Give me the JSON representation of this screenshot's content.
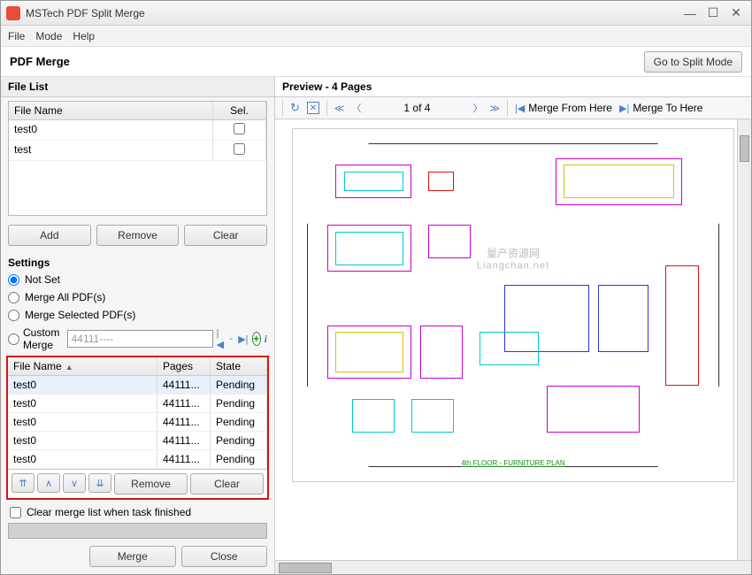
{
  "window": {
    "title": "MSTech PDF Split Merge"
  },
  "menu": {
    "file": "File",
    "mode": "Mode",
    "help": "Help"
  },
  "subtitle": "PDF Merge",
  "go_split": "Go to Split Mode",
  "filelist": {
    "title": "File List",
    "col_name": "File Name",
    "col_sel": "Sel.",
    "rows": [
      {
        "name": "test0",
        "sel": false
      },
      {
        "name": "test",
        "sel": false
      }
    ],
    "add": "Add",
    "remove": "Remove",
    "clear": "Clear"
  },
  "settings": {
    "title": "Settings",
    "not_set": "Not Set",
    "merge_all": "Merge All PDF(s)",
    "merge_selected": "Merge Selected PDF(s)",
    "custom_merge": "Custom Merge",
    "custom_value": "44111----"
  },
  "merge_grid": {
    "col_name": "File Name",
    "col_pages": "Pages",
    "col_state": "State",
    "rows": [
      {
        "name": "test0",
        "pages": "44111...",
        "state": "Pending"
      },
      {
        "name": "test0",
        "pages": "44111...",
        "state": "Pending"
      },
      {
        "name": "test0",
        "pages": "44111...",
        "state": "Pending"
      },
      {
        "name": "test0",
        "pages": "44111...",
        "state": "Pending"
      },
      {
        "name": "test0",
        "pages": "44111...",
        "state": "Pending"
      }
    ],
    "remove": "Remove",
    "clear": "Clear"
  },
  "clear_when_finished": "Clear merge list when task finished",
  "merge_btn": "Merge",
  "close_btn": "Close",
  "preview": {
    "title": "Preview - 4 Pages",
    "page_of": "1 of 4",
    "merge_from": "Merge From Here",
    "merge_to": "Merge To Here",
    "plan_label": "4th FLOOR - FURNITURE PLAN",
    "watermark1": "量产资源网",
    "watermark2": "Liangchan.net"
  }
}
